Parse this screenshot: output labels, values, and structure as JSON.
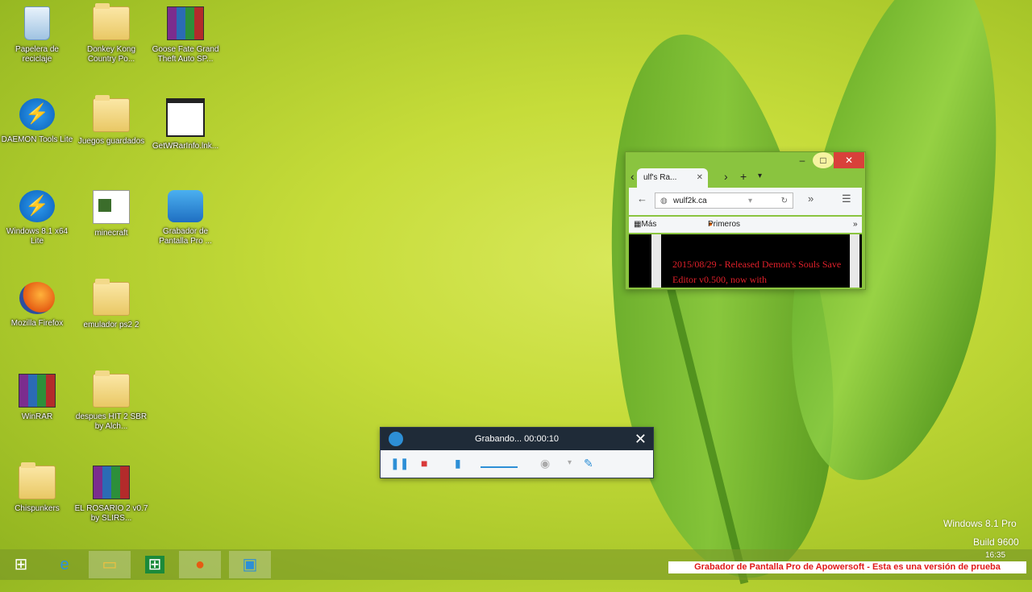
{
  "desktop": {
    "icons": [
      {
        "label": "Papelera de reciclaje",
        "icon": "recycle-bin-icon"
      },
      {
        "label": "Donkey Kong Country Po...",
        "icon": "folder-icon"
      },
      {
        "label": "Goose Fate Grand Theft Auto SP...",
        "icon": "winrar-icon"
      },
      {
        "label": "DAEMON Tools Lite",
        "icon": "daemon-tools-icon"
      },
      {
        "label": "Juegos guardados",
        "icon": "folder-icon"
      },
      {
        "label": "GetWRarInfo.lnk...",
        "icon": "window-icon"
      },
      {
        "label": "Windows 8.1 x64 Lite",
        "icon": "daemon-tools-icon"
      },
      {
        "label": "minecraft",
        "icon": "minecraft-icon"
      },
      {
        "label": "Grabador de Pantalla Pro ...",
        "icon": "screen-recorder-icon"
      },
      {
        "label": "Mozilla Firefox",
        "icon": "firefox-icon"
      },
      {
        "label": "emulador ps2 2",
        "icon": "folder-icon"
      },
      {
        "label": "WinRAR",
        "icon": "winrar-icon"
      },
      {
        "label": "despues HIT 2 SBR by Alch...",
        "icon": "folder-icon"
      },
      {
        "label": "Chispunkers",
        "icon": "folder-icon"
      },
      {
        "label": "EL ROSARIO 2 v0.7 by SLIRS...",
        "icon": "winrar-icon"
      }
    ]
  },
  "firefox": {
    "tab_label": "ulf's Ra...",
    "url": "wulf2k.ca",
    "bookmarks": [
      "Más visitados",
      "Primeros pasos"
    ],
    "content_text": "2015/08/29 - Released Demon's Souls Save Editor v0.500, now with"
  },
  "recorder": {
    "status": "Grabando... 00:00:10"
  },
  "watermark": {
    "line1": "Windows 8.1 Pro",
    "line2": "Build 9600",
    "clock": "16:35"
  },
  "banner": "Grabador de Pantalla Pro de Apowersoft - Esta es una versión de prueba"
}
